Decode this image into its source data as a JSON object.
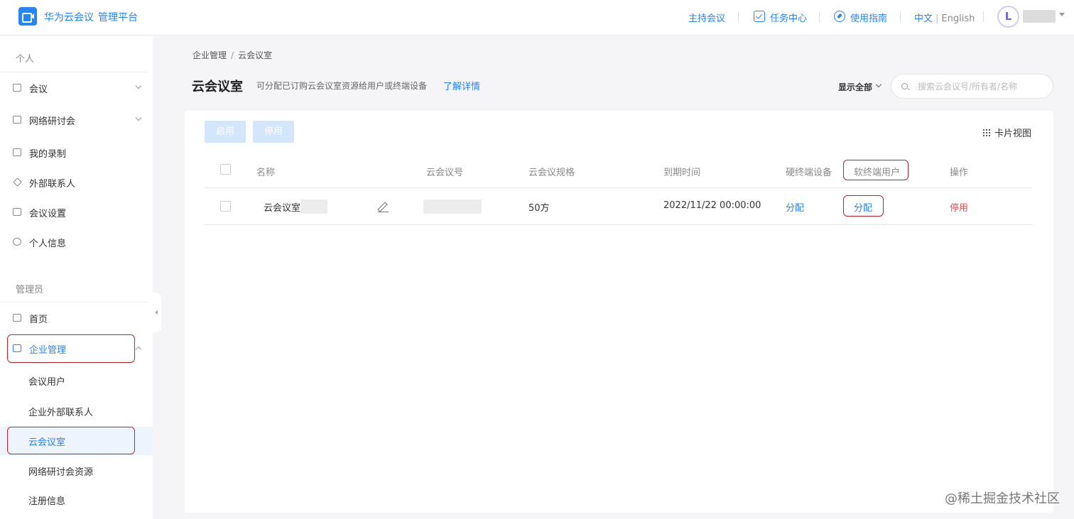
{
  "header": {
    "brand_name": "华为云会议",
    "brand_sub": "管理平台",
    "host_meeting": "主持会议",
    "task_center": "任务中心",
    "user_guide": "使用指南",
    "lang_zh": "中文",
    "lang_sep": "|",
    "lang_en": "English",
    "avatar_letter": "L"
  },
  "sidebar": {
    "personal_title": "个人",
    "personal_items": [
      {
        "label": "会议",
        "icon": "calendar-icon",
        "expandable": true
      },
      {
        "label": "网络研讨会",
        "icon": "webinar-icon",
        "expandable": true
      },
      {
        "label": "我的录制",
        "icon": "record-icon",
        "expandable": false
      },
      {
        "label": "外部联系人",
        "icon": "contact-icon",
        "expandable": false
      },
      {
        "label": "会议设置",
        "icon": "settings-icon",
        "expandable": false
      },
      {
        "label": "个人信息",
        "icon": "user-icon",
        "expandable": false
      }
    ],
    "admin_title": "管理员",
    "admin_items": [
      {
        "label": "首页",
        "icon": "home-icon"
      },
      {
        "label": "企业管理",
        "icon": "enterprise-icon",
        "expanded": true
      }
    ],
    "enterprise_subitems": [
      {
        "label": "会议用户"
      },
      {
        "label": "企业外部联系人"
      },
      {
        "label": "云会议室",
        "selected": true
      },
      {
        "label": "网络研讨会资源"
      },
      {
        "label": "注册信息"
      }
    ]
  },
  "main": {
    "breadcrumb": [
      "企业管理",
      "云会议室"
    ],
    "breadcrumb_sep": "/",
    "title": "云会议室",
    "description": "可分配已订购云会议室资源给用户或终端设备",
    "learn_more": "了解详情",
    "filter_label": "显示全部",
    "search_placeholder": "搜索云会议号/所有者/名称",
    "enable_button": "启用",
    "disable_button": "停用",
    "card_view": "卡片视图",
    "table": {
      "columns": [
        "名称",
        "云会议号",
        "云会议规格",
        "到期时间",
        "硬终端设备",
        "软终端用户",
        "操作"
      ],
      "rows": [
        {
          "name": "云会议室",
          "spec": "50方",
          "expiry": "2022/11/22 00:00:00",
          "hard_terminal_action": "分配",
          "soft_terminal_action": "分配",
          "operation": "停用"
        }
      ]
    }
  },
  "watermark": "@稀土掘金技术社区",
  "colors": {
    "accent": "#2684f6",
    "highlight_box": "#b3262d",
    "danger": "#e45454",
    "disabled_button": "#d4e6fc"
  }
}
